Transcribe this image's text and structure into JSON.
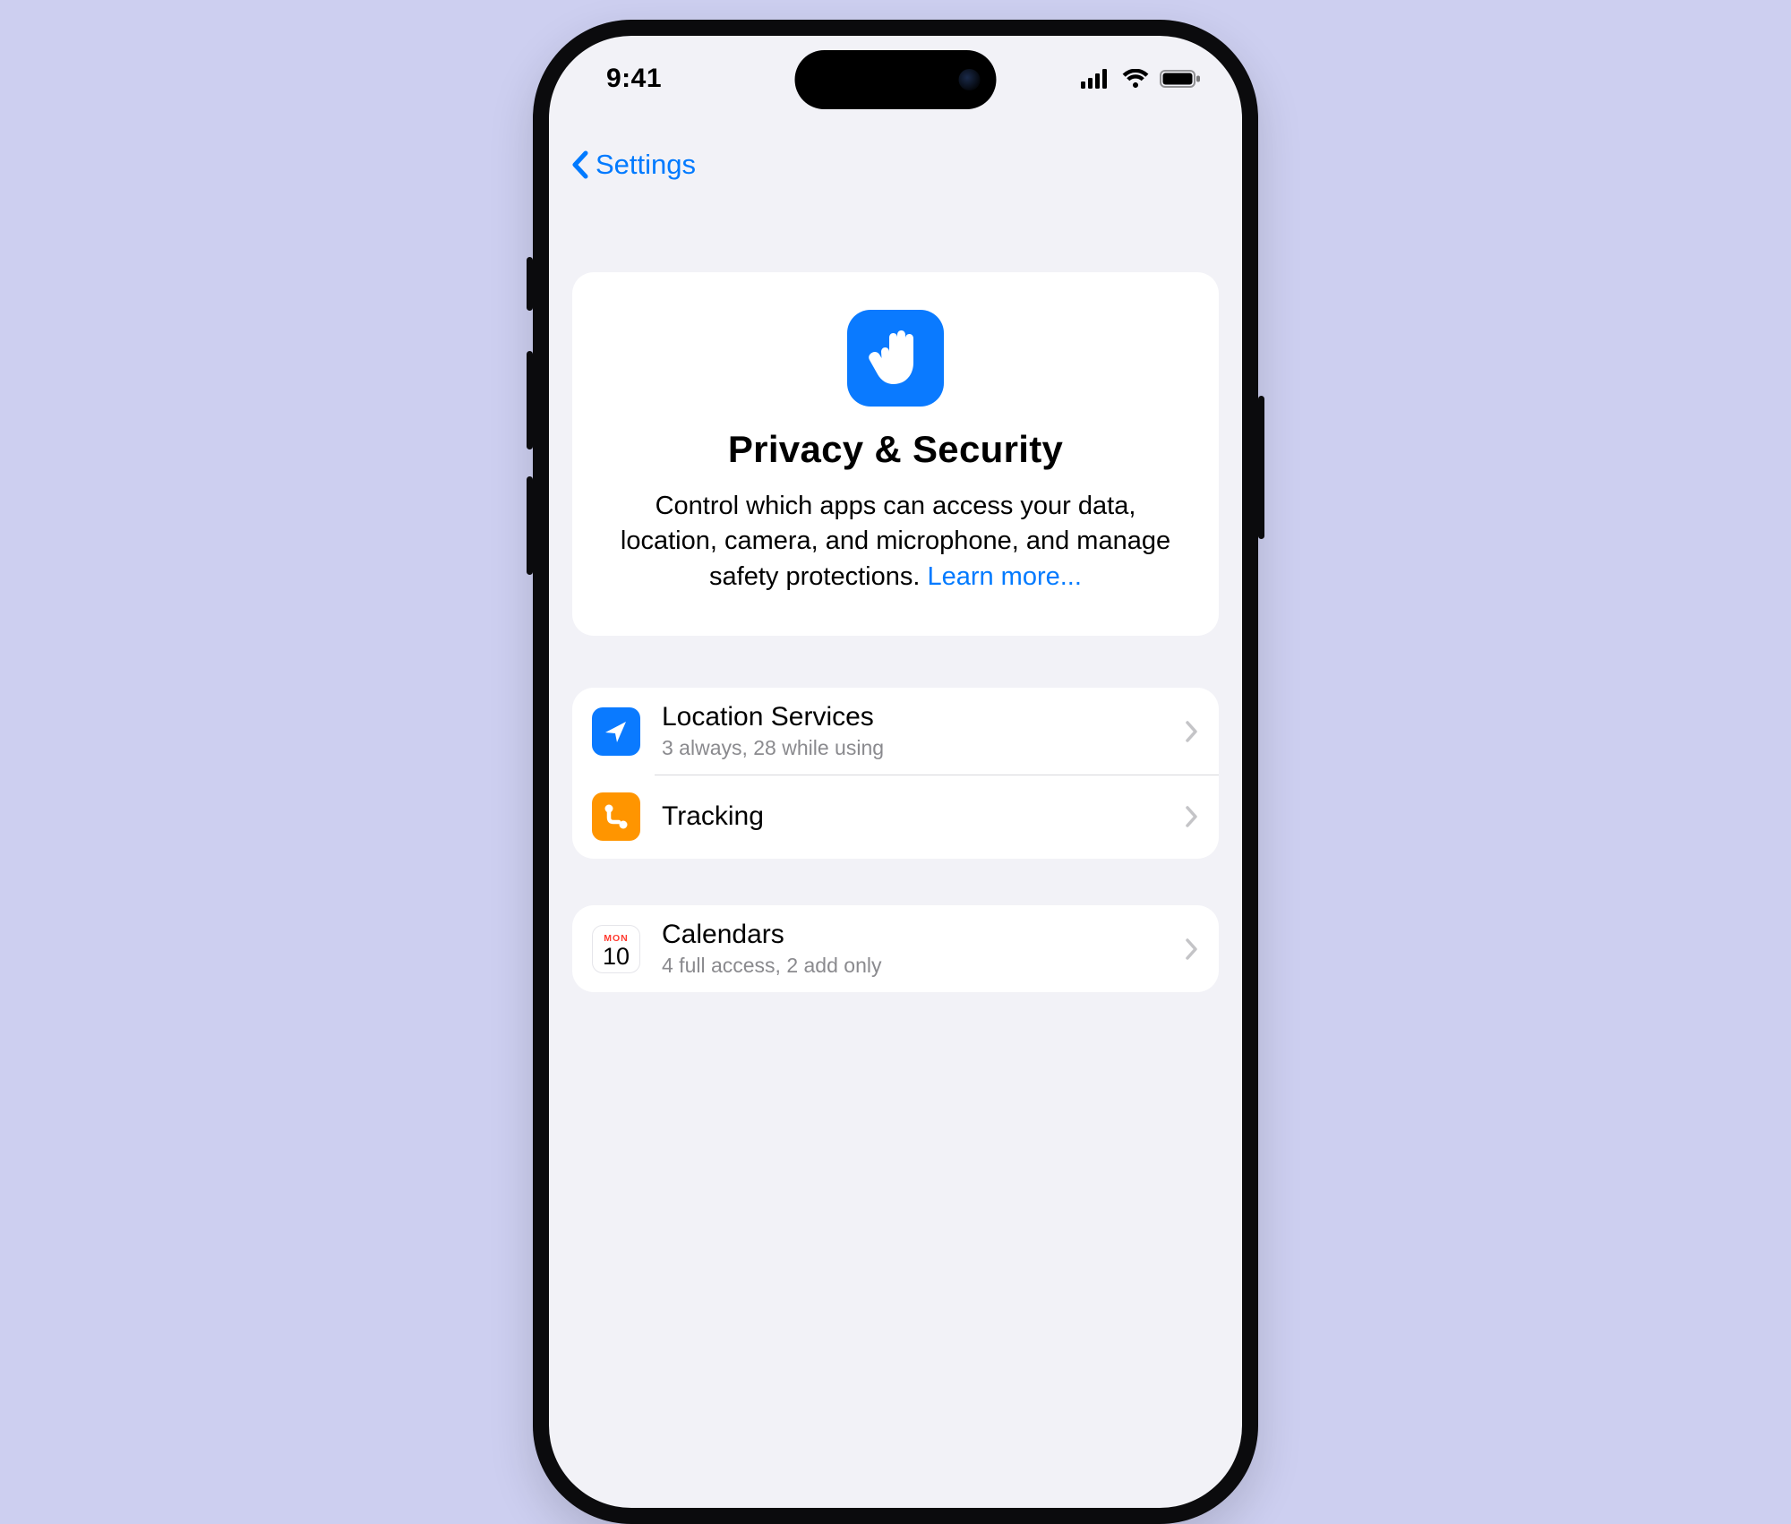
{
  "status": {
    "time": "9:41"
  },
  "nav": {
    "back_label": "Settings"
  },
  "header": {
    "title": "Privacy & Security",
    "desc": "Control which apps can access your data, location, camera, and microphone, and manage safety protections. ",
    "learn_more": "Learn more..."
  },
  "group1": {
    "location": {
      "title": "Location Services",
      "sub": "3 always, 28 while using"
    },
    "tracking": {
      "title": "Tracking"
    }
  },
  "group2": {
    "calendars": {
      "title": "Calendars",
      "sub": "4 full access, 2 add only",
      "icon_day": "MON",
      "icon_num": "10"
    }
  }
}
